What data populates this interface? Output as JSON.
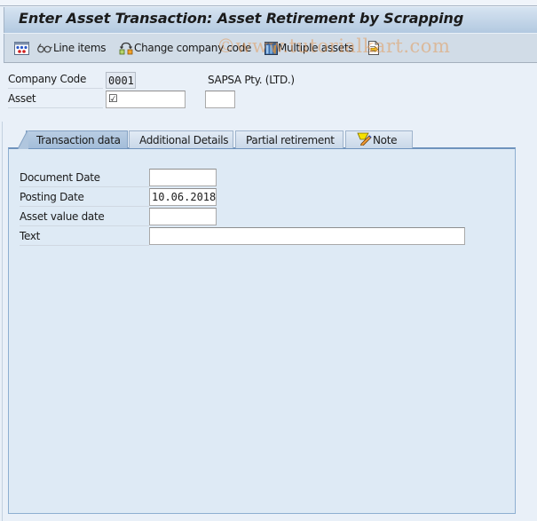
{
  "window": {
    "title": "Enter Asset Transaction: Asset Retirement by Scrapping"
  },
  "toolbar": {
    "items": [
      {
        "label": "",
        "icon": "structure-icon"
      },
      {
        "label": "Line items",
        "icon": "glasses-icon"
      },
      {
        "label": "Change company code",
        "icon": "change-company-icon"
      },
      {
        "label": "Multiple assets",
        "icon": "multiple-assets-icon"
      },
      {
        "label": "",
        "icon": "export-document-icon"
      }
    ]
  },
  "watermark": "©www.tutorialkart.com",
  "header_fields": {
    "company_code": {
      "label": "Company Code",
      "value": "0001",
      "name": "SAPSA Pty. (LTD.)"
    },
    "asset": {
      "label": "Asset",
      "value": "",
      "required_marker": "☑",
      "sub_number": ""
    }
  },
  "tabs": [
    {
      "label": "Transaction data",
      "active": true
    },
    {
      "label": "Additional Details",
      "active": false
    },
    {
      "label": "Partial retirement",
      "active": false
    },
    {
      "label": "Note",
      "active": false,
      "icon": "note-pencil-icon"
    }
  ],
  "transaction_data": {
    "fields": [
      {
        "label": "Document Date",
        "value": ""
      },
      {
        "label": "Posting Date",
        "value": "10.06.2018"
      },
      {
        "label": "Asset value date",
        "value": ""
      },
      {
        "label": "Text",
        "value": ""
      }
    ]
  },
  "colors": {
    "title_gradient_top": "#d6e3f1",
    "title_gradient_bottom": "#b2c9e0",
    "toolbar_bg": "#d1dce7",
    "page_bg": "#e9f0f8",
    "panel_bg": "#deeaf5",
    "panel_border": "#8dafd1"
  }
}
